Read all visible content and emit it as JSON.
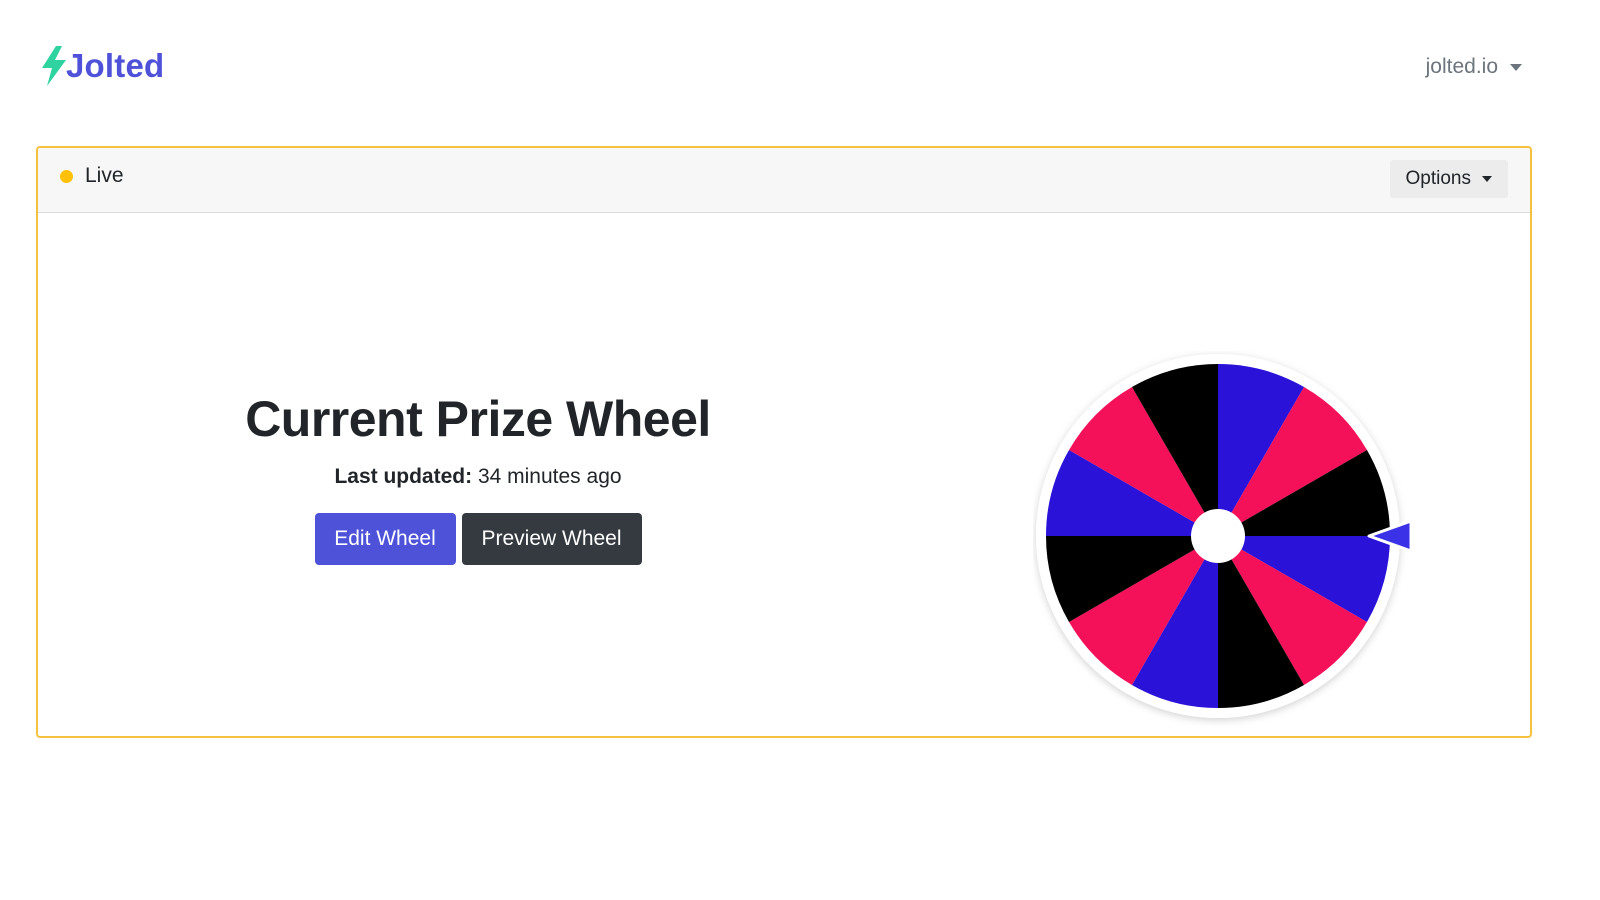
{
  "brand": {
    "name": "Jolted",
    "logo_icon": "lightning-bolt-icon",
    "accent": "#4f52d9",
    "bolt_color": "#2fd3a0"
  },
  "header": {
    "account_label": "jolted.io"
  },
  "card": {
    "status_label": "Live",
    "status_color": "#ffc107",
    "border_color": "#f6c23e",
    "options_label": "Options"
  },
  "main": {
    "title": "Current Prize Wheel",
    "updated_label": "Last updated:",
    "updated_value": "34 minutes ago",
    "edit_button": "Edit Wheel",
    "preview_button": "Preview Wheel"
  },
  "wheel": {
    "segment_count": 12,
    "segment_colors": [
      "#2a12d8",
      "#f5105a",
      "#000000",
      "#2a12d8",
      "#f5105a",
      "#000000",
      "#2a12d8",
      "#f5105a",
      "#000000",
      "#2a12d8",
      "#f5105a",
      "#000000"
    ],
    "pointer_color": "#3b32e8",
    "pointer_icon": "pointer-triangle-icon"
  }
}
